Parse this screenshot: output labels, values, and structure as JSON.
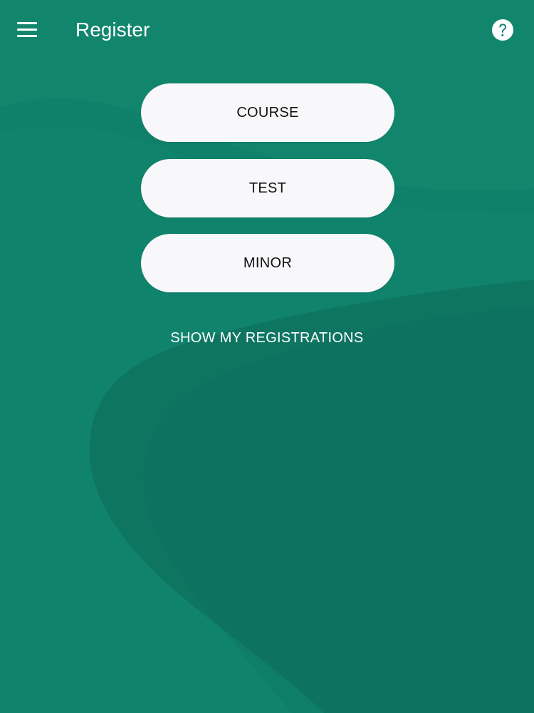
{
  "appbar": {
    "title": "Register",
    "menu_icon": "hamburger-menu-icon",
    "help_icon": "help-circle-icon"
  },
  "actions": {
    "course_label": "COURSE",
    "test_label": "TEST",
    "minor_label": "MINOR",
    "show_registrations_label": "SHOW MY REGISTRATIONS"
  },
  "colors": {
    "background": "#10836c",
    "background_shade": "#0e725e",
    "button_fill": "#f8f7fa",
    "button_text": "#111111",
    "appbar_text": "#ffffff"
  }
}
